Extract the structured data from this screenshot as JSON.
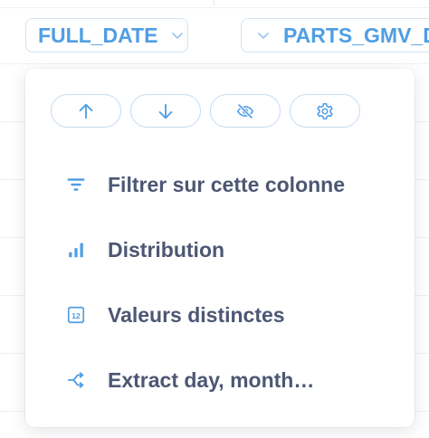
{
  "columns": {
    "full_date": {
      "label": "FULL_DATE"
    },
    "parts_gmv": {
      "label": "PARTS_GMV_DA"
    }
  },
  "popover": {
    "actions": [
      {
        "icon": "arrow-up-icon",
        "label": "sort-ascending"
      },
      {
        "icon": "arrow-down-icon",
        "label": "sort-descending"
      },
      {
        "icon": "eye-off-icon",
        "label": "hide-column"
      },
      {
        "icon": "gear-icon",
        "label": "column-settings"
      }
    ],
    "menu": [
      {
        "icon": "filter-icon",
        "label": "Filtrer sur cette colonne"
      },
      {
        "icon": "bar-chart-icon",
        "label": "Distribution"
      },
      {
        "icon": "calendar-12-icon",
        "label": "Valeurs distinctes",
        "icon_text": "12"
      },
      {
        "icon": "extract-icon",
        "label": "Extract day, month…"
      }
    ]
  },
  "colors": {
    "accent": "#509ee3",
    "text": "#4c5773",
    "border": "#c6dcf2"
  }
}
